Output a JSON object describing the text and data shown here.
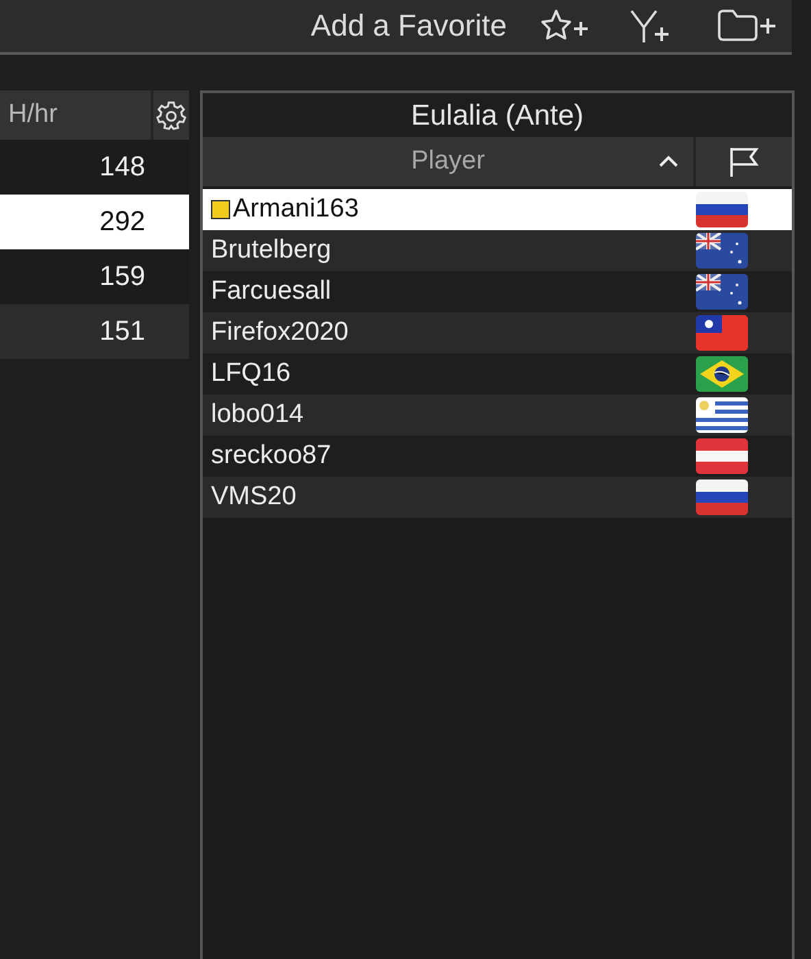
{
  "toolbar": {
    "label": "Add a Favorite"
  },
  "stats_table": {
    "column": "H/hr",
    "rows": [
      {
        "value": "148",
        "selected": false
      },
      {
        "value": "292",
        "selected": true
      },
      {
        "value": "159",
        "selected": false
      },
      {
        "value": "151",
        "selected": false
      }
    ]
  },
  "players_panel": {
    "title": "Eulalia (Ante)",
    "column": "Player",
    "rows": [
      {
        "name": "Armani163",
        "selected": true,
        "color": "#f2cc1c",
        "kind": "tricolor"
      },
      {
        "name": "Brutelberg",
        "selected": false,
        "kind": "ensign"
      },
      {
        "name": "Farcuesall",
        "selected": false,
        "kind": "ensign"
      },
      {
        "name": "Firefox2020",
        "selected": false,
        "kind": "canton"
      },
      {
        "name": "LFQ16",
        "selected": false,
        "kind": "rhombus"
      },
      {
        "name": "lobo014",
        "selected": false,
        "kind": "stripes"
      },
      {
        "name": "sreckoo87",
        "selected": false,
        "kind": "triband"
      },
      {
        "name": "VMS20",
        "selected": false,
        "kind": "tricolor"
      }
    ]
  }
}
